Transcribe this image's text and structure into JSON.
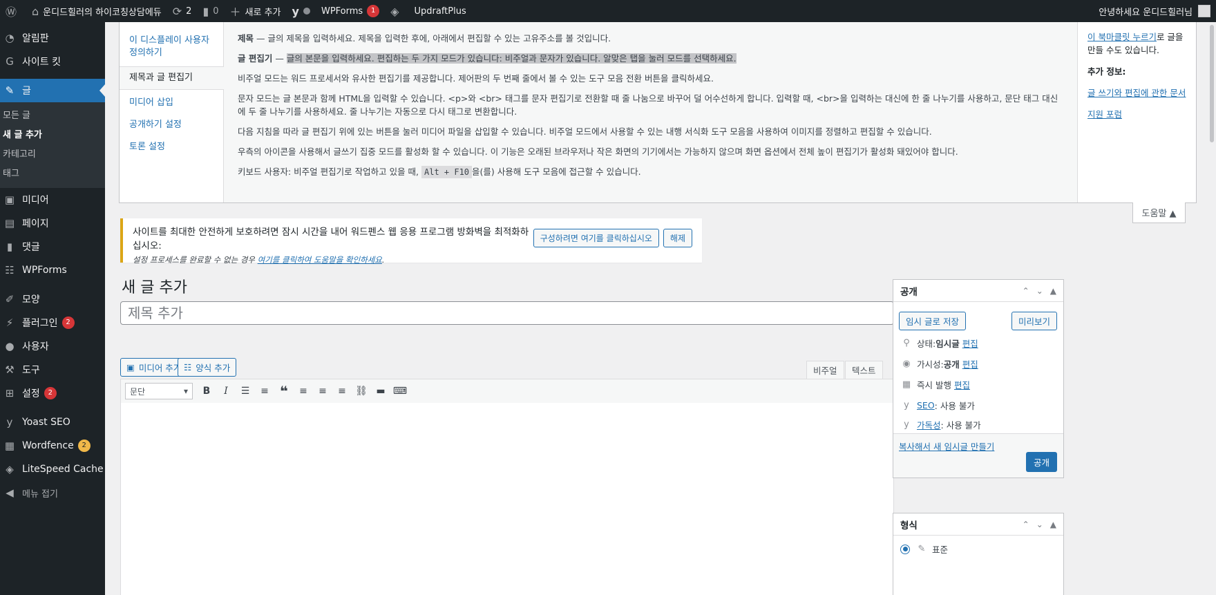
{
  "adminbar": {
    "site_name": "운디드힐러의 하이코칭상담에듀",
    "updates_count": "2",
    "comments_count": "0",
    "new_label": "새로 추가",
    "wpforms_label": "WPForms",
    "wpforms_badge": "1",
    "updraft_label": "UpdraftPlus",
    "greeting": "안녕하세요 운디드힐러님"
  },
  "sidebar": {
    "items": [
      {
        "label": "알림판",
        "icon": "dashboard-icon"
      },
      {
        "label": "사이트 킷",
        "icon": "google-icon"
      },
      {
        "label": "글",
        "icon": "pushpin-icon"
      },
      {
        "label": "미디어",
        "icon": "media-icon"
      },
      {
        "label": "페이지",
        "icon": "page-icon"
      },
      {
        "label": "댓글",
        "icon": "comment-icon"
      },
      {
        "label": "WPForms",
        "icon": "forms-icon"
      },
      {
        "label": "모양",
        "icon": "brush-icon"
      },
      {
        "label": "플러그인",
        "icon": "plugin-icon",
        "badge": "2"
      },
      {
        "label": "사용자",
        "icon": "user-icon"
      },
      {
        "label": "도구",
        "icon": "wrench-icon"
      },
      {
        "label": "설정",
        "icon": "settings-icon",
        "badge": "2"
      },
      {
        "label": "Yoast SEO",
        "icon": "yoast-icon"
      },
      {
        "label": "Wordfence",
        "icon": "wordfence-icon",
        "badge": "2"
      },
      {
        "label": "LiteSpeed Cache",
        "icon": "litespeed-icon"
      },
      {
        "label": "메뉴 접기",
        "icon": "collapse-icon"
      }
    ],
    "submenu": [
      "모든 글",
      "새 글 추가",
      "카테고리",
      "태그"
    ]
  },
  "help": {
    "tabs": [
      "이 디스플레이 사용자 정의하기",
      "제목과 글 편집기",
      "미디어 삽입",
      "공개하기 설정",
      "토론 설정"
    ],
    "p1_strong": "제목",
    "p1_text": " — 글의 제목을 입력하세요. 제목을 입력한 후에, 아래에서 편집할 수 있는 고유주소를 볼 것입니다.",
    "p2_strong": "글 편집기",
    "p2_dash": " — ",
    "p2_text": "글의 본문을 입력하세요. 편집하는 두 가지 모드가 있습니다: 비주얼과 문자가 있습니다. 알맞은 탭을 눌러 모드를 선택하세요.",
    "p3": "비주얼 모드는 워드 프로세서와 유사한 편집기를 제공합니다. 제어판의 두 번째 줄에서 볼 수 있는 도구 모음 전환 버튼을 클릭하세요.",
    "p4": "문자 모드는 글 본문과 함께 HTML을 입력할 수 있습니다. <p>와 <br> 태그를 문자 편집기로 전환할 때 줄 나눔으로 바꾸어 덜 어수선하게 합니다. 입력할 때, <br>을 입력하는 대신에 한 줄 나누기를 사용하고, 문단 태그 대신에 두 줄 나누기를 사용하세요. 줄 나누기는 자동으로 다시 태그로 변환합니다.",
    "p5": "다음 지침을 따라 글 편집기 위에 있는 버튼을 눌러 미디어 파일을 삽입할 수 있습니다. 비주얼 모드에서 사용할 수 있는 내행 서식화 도구 모음을 사용하여 이미지를 정렬하고 편집할 수 있습니다.",
    "p6": "우측의 아이콘을 사용해서 글쓰기 집중 모드를 활성화 할 수 있습니다. 이 기능은 오래된 브라우저나 작은 화면의 기기에서는 가능하지 않으며 화면 옵션에서 전체 높이 편집기가 활성화 돼있어야 합니다.",
    "p7_before": "키보드 사용자: 비주얼 편집기로 작업하고 있을 때, ",
    "p7_code": "Alt + F10",
    "p7_after": "을(를) 사용해 도구 모음에 접근할 수 있습니다.",
    "side_link1": "이 북마클릿 누르기",
    "side_text1": "로 글을 만들 수도 있습니다.",
    "side_heading": "추가 정보:",
    "side_link2": "글 쓰기와 편집에 관한 문서",
    "side_link3": "지원 포럼",
    "toggle_label": "도움말 ▲"
  },
  "notice": {
    "text": "사이트를 최대한 안전하게 보호하려면 잠시 시간을 내어 워드펜스 웹 응용 프로그램 방화벽을 최적화하십시오:",
    "configure_button": "구성하려면 여기를 클릭하십시오",
    "dismiss_button": "해제",
    "italic_before": "설정 프로세스를 완료할 수 없는 경우 ",
    "italic_link": "여기를 클릭하여 도움말을 확인하세요",
    "italic_after": "."
  },
  "page": {
    "title": "새 글 추가",
    "title_placeholder": "제목 추가"
  },
  "editor": {
    "add_media": "미디어 추가",
    "add_form": "양식 추가",
    "tab_visual": "비주얼",
    "tab_text": "텍스트",
    "format_select": "문단"
  },
  "publish": {
    "heading": "공개",
    "save_draft": "임시 글로 저장",
    "preview": "미리보기",
    "status_label": "상태: ",
    "status_value": "임시글",
    "visibility_label": "가시성: ",
    "visibility_value": "공개",
    "schedule_label": "즉시 발행",
    "edit": "편집",
    "seo_link": "SEO",
    "seo_value": ": 사용 불가",
    "readability_link": "가독성",
    "readability_value": ": 사용 불가",
    "copy_link": "복사해서 새 임시글 만들기",
    "publish_button": "공개"
  },
  "format_box": {
    "heading": "형식",
    "option_standard": "표준"
  },
  "colors": {
    "admin_dark": "#1d2327",
    "accent": "#2271b1",
    "badge": "#d63638",
    "notice_border": "#dba617"
  }
}
